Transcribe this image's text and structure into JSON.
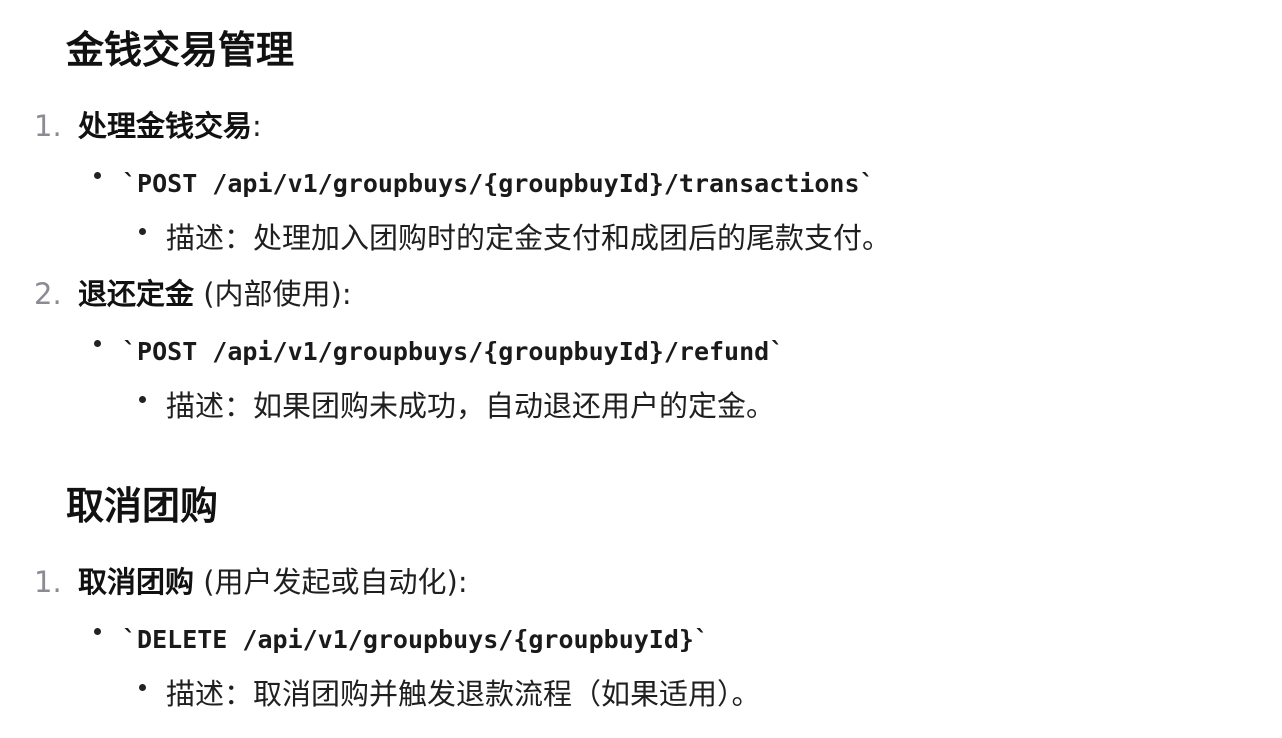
{
  "sections": [
    {
      "title": "金钱交易管理",
      "items": [
        {
          "number": "1.",
          "label": "处理金钱交易",
          "suffix": ":",
          "endpoint": "`POST /api/v1/groupbuys/{groupbuyId}/transactions`",
          "description": "描述：处理加入团购时的定金支付和成团后的尾款支付。"
        },
        {
          "number": "2.",
          "label": "退还定金",
          "suffix": " (内部使用):",
          "endpoint": "`POST /api/v1/groupbuys/{groupbuyId}/refund`",
          "description": "描述：如果团购未成功，自动退还用户的定金。"
        }
      ]
    },
    {
      "title": "取消团购",
      "items": [
        {
          "number": "1.",
          "label": "取消团购",
          "suffix": " (用户发起或自动化):",
          "endpoint": "`DELETE /api/v1/groupbuys/{groupbuyId}`",
          "description": "描述：取消团购并触发退款流程（如果适用）。"
        }
      ]
    }
  ]
}
